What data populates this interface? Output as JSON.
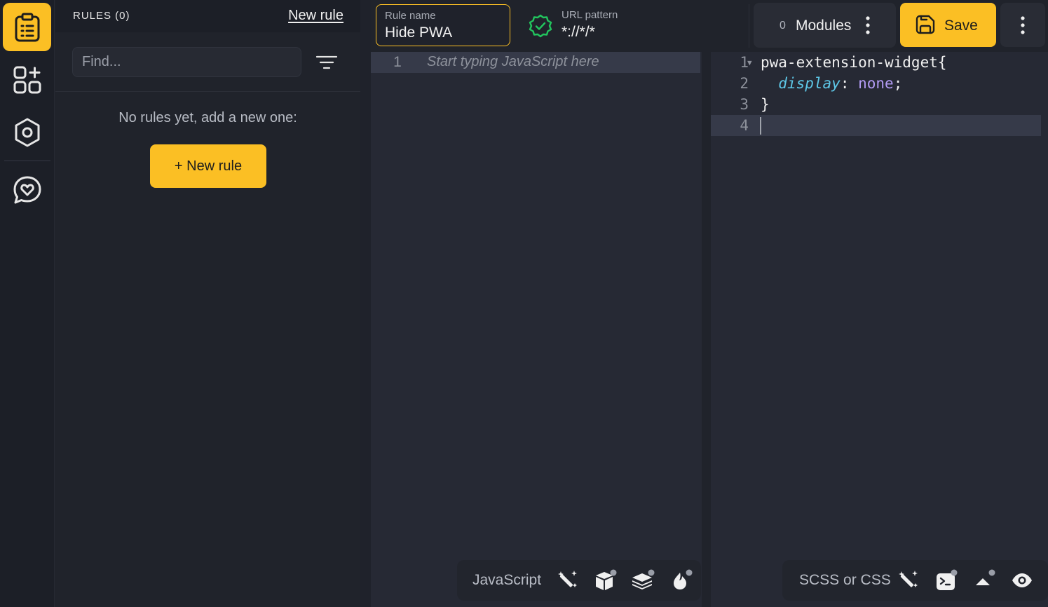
{
  "sidebar": {
    "rules_title": "RULES (0)",
    "new_rule_link": "New rule",
    "find_placeholder": "Find...",
    "empty_message": "No rules yet, add a new one:",
    "new_rule_button": "+ New rule"
  },
  "header": {
    "rule_name_label": "Rule name",
    "rule_name_value": "Hide PWA",
    "url_pattern_label": "URL pattern",
    "url_pattern_value": "*://*/*",
    "modules_count": "0",
    "modules_label": "Modules",
    "save_label": "Save"
  },
  "js_editor": {
    "line_number": "1",
    "placeholder": "Start typing JavaScript here",
    "language": "JavaScript"
  },
  "css_editor": {
    "language": "SCSS or CSS",
    "lines": [
      {
        "num": "1",
        "selector": "pwa-extension-widget{"
      },
      {
        "num": "2",
        "property": "display",
        "colon": ": ",
        "value": "none",
        "semi": ";"
      },
      {
        "num": "3",
        "text": "}"
      },
      {
        "num": "4",
        "text": ""
      }
    ]
  },
  "colors": {
    "accent": "#fbbf24",
    "check": "#22c55e"
  }
}
